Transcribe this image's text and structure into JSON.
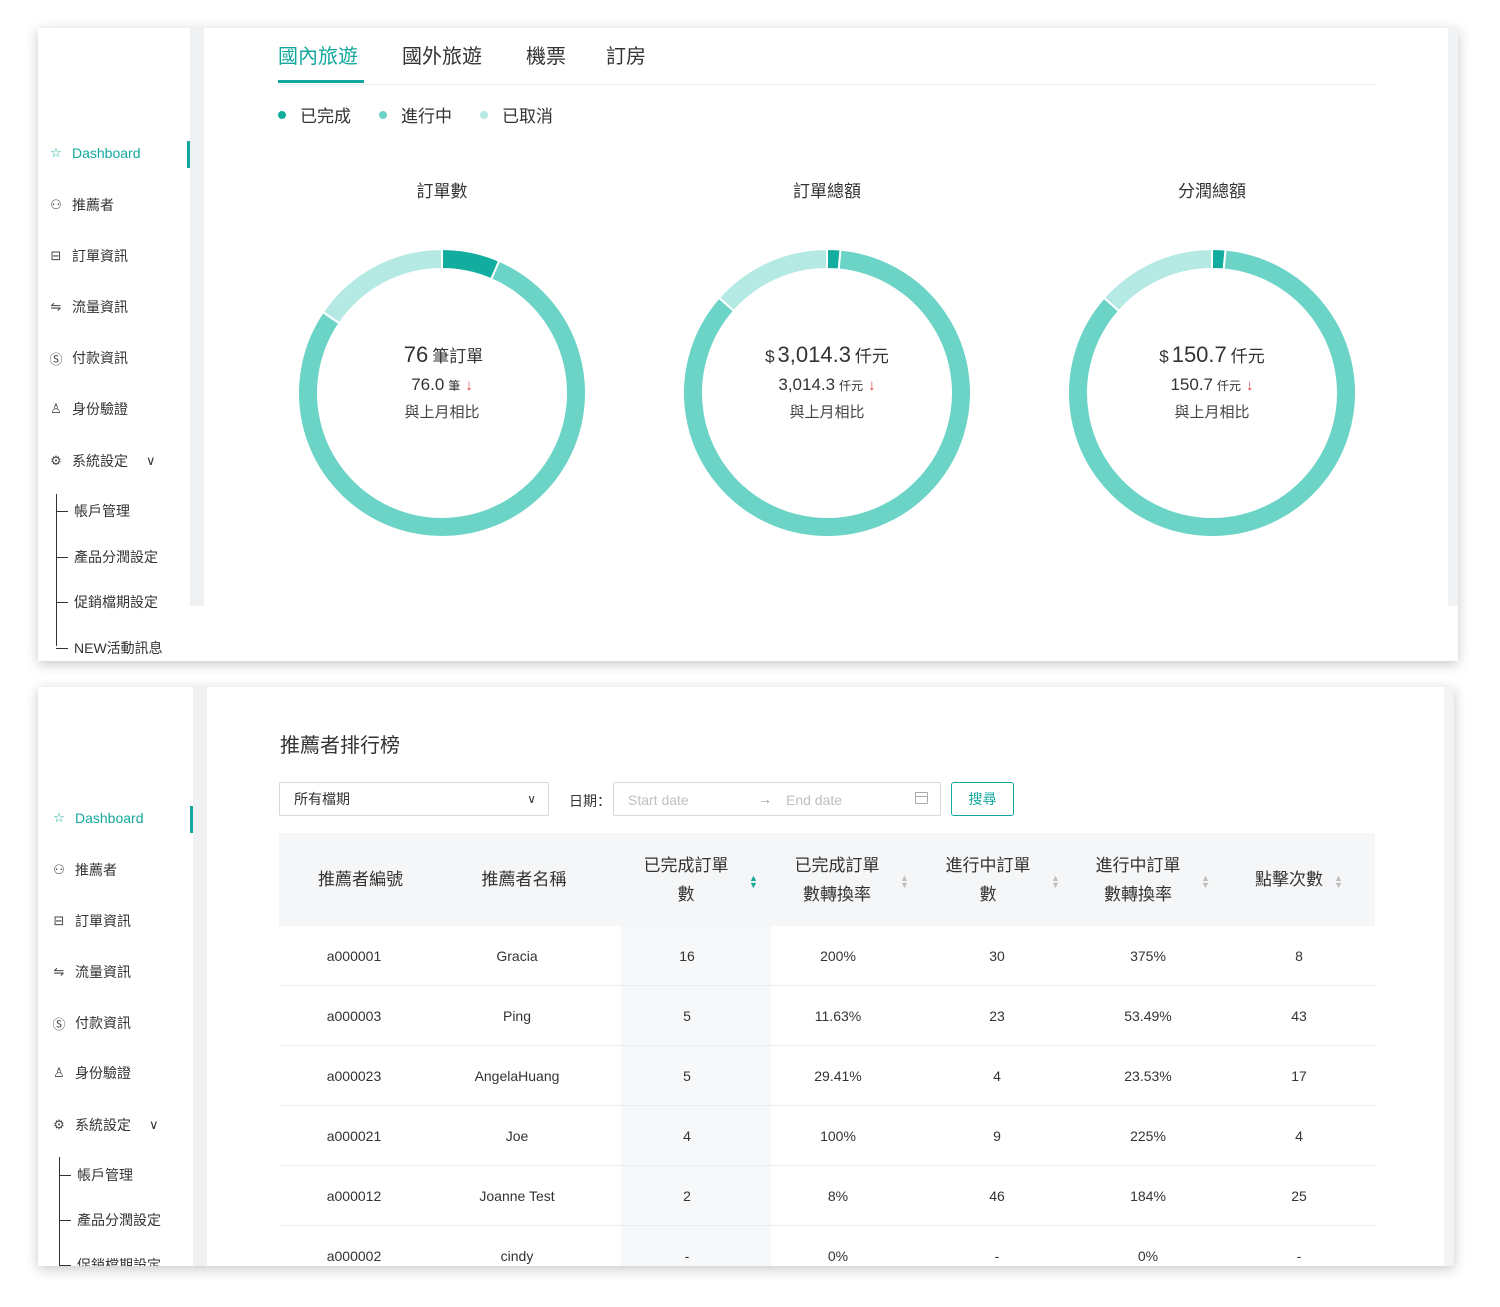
{
  "sidebar": {
    "items": [
      {
        "label": "Dashboard",
        "icon": "star-icon",
        "active": true
      },
      {
        "label": "推薦者",
        "icon": "user-group-icon"
      },
      {
        "label": "訂單資訊",
        "icon": "order-icon"
      },
      {
        "label": "流量資訊",
        "icon": "swap-icon"
      },
      {
        "label": "付款資訊",
        "icon": "dollar-icon"
      },
      {
        "label": "身份驗證",
        "icon": "user-icon"
      },
      {
        "label": "系統設定",
        "icon": "gear-icon"
      }
    ],
    "sub_items": [
      "帳戶管理",
      "產品分潤設定",
      "促銷檔期設定",
      "NEW活動訊息"
    ]
  },
  "tabs": [
    "國內旅遊",
    "國外旅遊",
    "機票",
    "訂房"
  ],
  "legend": [
    {
      "label": "已完成",
      "color": "#13ad9f"
    },
    {
      "label": "進行中",
      "color": "#6cd3c7"
    },
    {
      "label": "已取消",
      "color": "#b5e9e4"
    }
  ],
  "charts": [
    {
      "title": "訂單數",
      "prefix": "",
      "main_value": "76",
      "main_unit": "筆訂單",
      "sub_value": "76.0",
      "sub_unit": "筆",
      "note": "與上月相比"
    },
    {
      "title": "訂單總額",
      "prefix": "$",
      "main_value": "3,014.3",
      "main_unit": "仟元",
      "sub_value": "3,014.3",
      "sub_unit": "仟元",
      "note": "與上月相比"
    },
    {
      "title": "分潤總額",
      "prefix": "$",
      "main_value": "150.7",
      "main_unit": "仟元",
      "sub_value": "150.7",
      "sub_unit": "仟元",
      "note": "與上月相比"
    }
  ],
  "chart_data": [
    {
      "type": "pie",
      "title": "訂單數",
      "labels": [
        "已完成",
        "進行中",
        "已取消"
      ],
      "values": [
        6.5,
        78.0,
        15.5
      ]
    },
    {
      "type": "pie",
      "title": "訂單總額",
      "labels": [
        "已完成",
        "進行中",
        "已取消"
      ],
      "values": [
        1.5,
        85.0,
        13.5
      ]
    },
    {
      "type": "pie",
      "title": "分潤總額",
      "labels": [
        "已完成",
        "進行中",
        "已取消"
      ],
      "values": [
        1.5,
        85.0,
        13.5
      ]
    }
  ],
  "ranking": {
    "title": "推薦者排行榜",
    "period_select": "所有檔期",
    "date_label": "日期：",
    "start_placeholder": "Start date",
    "end_placeholder": "End date",
    "search_label": "搜尋",
    "columns": [
      [
        "推薦者編號"
      ],
      [
        "推薦者名稱"
      ],
      [
        "已完成訂單",
        "數"
      ],
      [
        "已完成訂單",
        "數轉換率"
      ],
      [
        "進行中訂單",
        "數"
      ],
      [
        "進行中訂單",
        "數轉換率"
      ],
      [
        "點擊次數"
      ]
    ],
    "rows": [
      [
        "a000001",
        "Gracia",
        "16",
        "200%",
        "30",
        "375%",
        "8"
      ],
      [
        "a000003",
        "Ping",
        "5",
        "11.63%",
        "23",
        "53.49%",
        "43"
      ],
      [
        "a000023",
        "AngelaHuang",
        "5",
        "29.41%",
        "4",
        "23.53%",
        "17"
      ],
      [
        "a000021",
        "Joe",
        "4",
        "100%",
        "9",
        "225%",
        "4"
      ],
      [
        "a000012",
        "Joanne Test",
        "2",
        "8%",
        "46",
        "184%",
        "25"
      ],
      [
        "a000002",
        "cindy",
        "-",
        "0%",
        "-",
        "0%",
        "-"
      ]
    ]
  }
}
